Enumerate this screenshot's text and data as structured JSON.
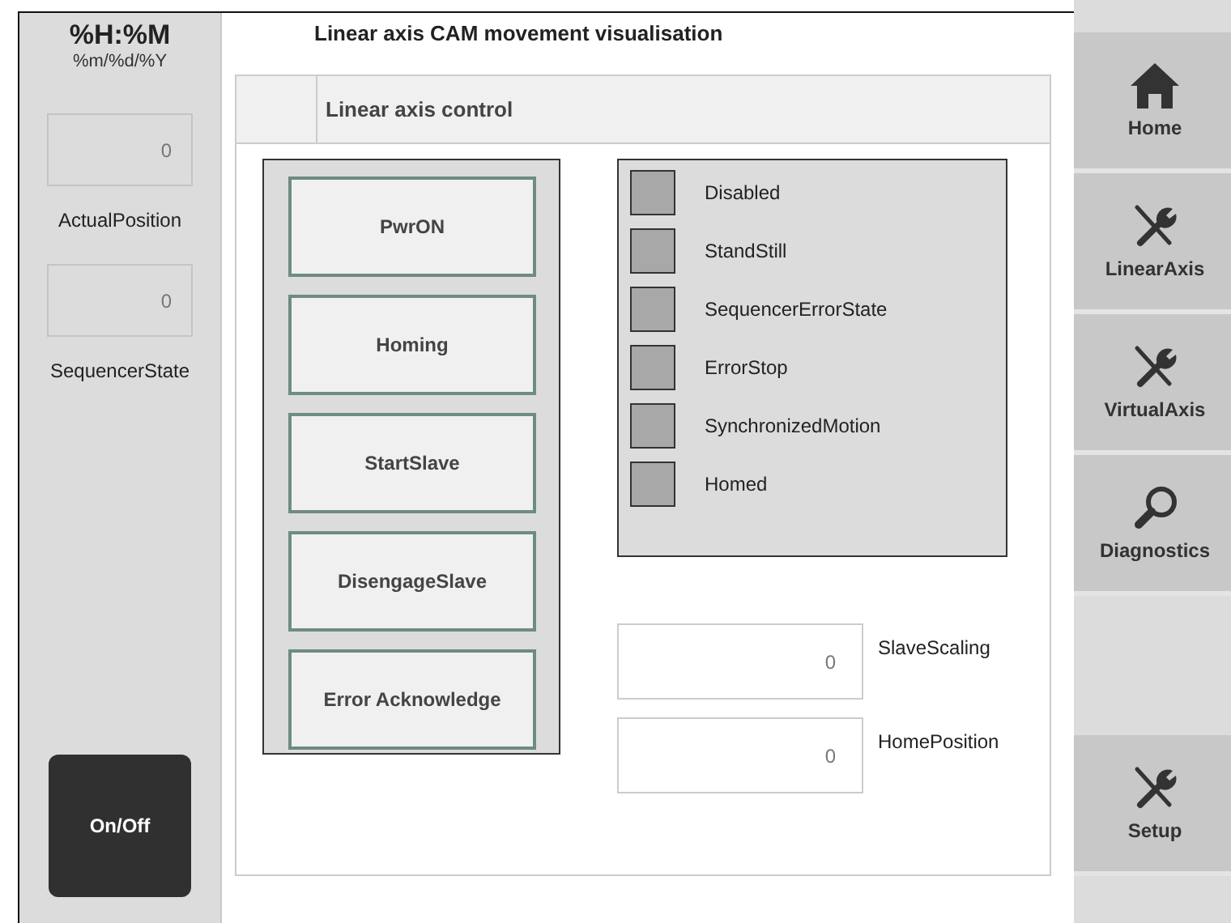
{
  "clock": {
    "time": "%H:%M",
    "date": "%m/%d/%Y"
  },
  "side_values": [
    {
      "value": "0",
      "label": "ActualPosition"
    },
    {
      "value": "0",
      "label": "SequencerState"
    }
  ],
  "power_button": "On/Off",
  "title": "Linear axis CAM movement visualisation",
  "tab": "Linear axis control",
  "commands": [
    "PwrON",
    "Homing",
    "StartSlave",
    "DisengageSlave",
    "Error Acknowledge"
  ],
  "indicators": [
    {
      "label": "Disabled",
      "on": false
    },
    {
      "label": "StandStill",
      "on": false
    },
    {
      "label": "SequencerErrorState",
      "on": false
    },
    {
      "label": "ErrorStop",
      "on": false
    },
    {
      "label": "SynchronizedMotion",
      "on": false
    },
    {
      "label": "Homed",
      "on": false
    }
  ],
  "parameters": [
    {
      "value": "0",
      "label": "SlaveScaling"
    },
    {
      "value": "0",
      "label": "HomePosition"
    }
  ],
  "nav": [
    {
      "label": "Home",
      "kind": "home"
    },
    {
      "label": "LinearAxis",
      "kind": "tools"
    },
    {
      "label": "VirtualAxis",
      "kind": "tools"
    },
    {
      "label": "Diagnostics",
      "kind": "search"
    },
    {
      "label": "Setup",
      "kind": "tools"
    }
  ]
}
